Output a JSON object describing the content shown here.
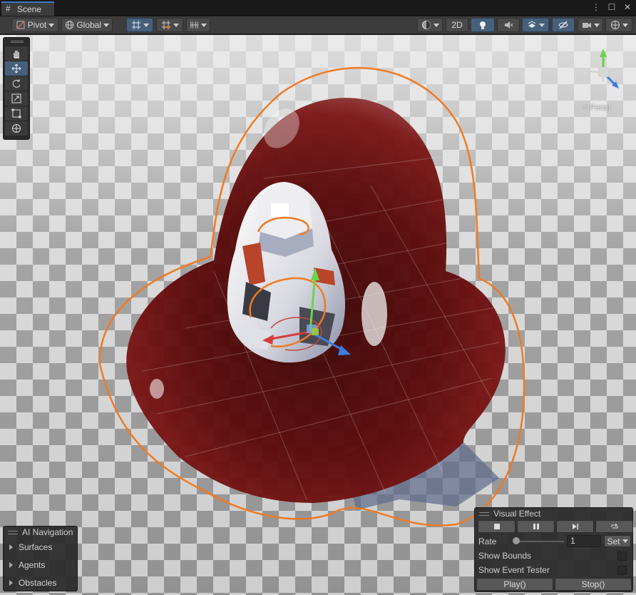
{
  "window": {
    "tab_label": "Scene",
    "menu_icon": "more-vertical-icon",
    "maximize_icon": "maximize-icon",
    "close_icon": "close-icon"
  },
  "toolbar": {
    "pivot_label": "Pivot",
    "global_label": "Global",
    "grid_snap_icon": "grid-snap-icon",
    "increment_snap_icon": "increment-snap-icon",
    "grid_visibility_icon": "grid-visibility-icon",
    "draw_mode_icon": "shading-mode-icon",
    "mode_2d_label": "2D",
    "lighting_icon": "lightbulb-icon",
    "audio_icon": "audio-mute-icon",
    "effects_icon": "effects-icon",
    "hidden_icon": "hidden-objects-icon",
    "camera_icon": "camera-icon",
    "gizmos_icon": "gizmos-icon"
  },
  "tools": [
    {
      "name": "hand-tool",
      "icon": "hand-icon",
      "active": false
    },
    {
      "name": "move-tool",
      "icon": "move-icon",
      "active": true
    },
    {
      "name": "rotate-tool",
      "icon": "rotate-icon",
      "active": false
    },
    {
      "name": "scale-tool",
      "icon": "scale-icon",
      "active": false
    },
    {
      "name": "rect-tool",
      "icon": "rect-icon",
      "active": false
    },
    {
      "name": "transform-tool",
      "icon": "transform-icon",
      "active": false
    }
  ],
  "gizmo": {
    "axis_x": "x",
    "axis_y": "y",
    "axis_z": "z",
    "projection_label": "< Persp"
  },
  "ai_navigation": {
    "title": "AI Navigation",
    "items": [
      "Surfaces",
      "Agents",
      "Obstacles"
    ]
  },
  "visual_effect": {
    "title": "Visual Effect",
    "controls": [
      "stop-icon",
      "pause-icon",
      "step-icon",
      "restart-icon"
    ],
    "rate_label": "Rate",
    "rate_value": "1",
    "set_label": "Set",
    "show_bounds_label": "Show Bounds",
    "show_event_tester_label": "Show Event Tester",
    "play_label": "Play()",
    "stop_label": "Stop()"
  },
  "colors": {
    "accent_blue": "#46607c",
    "bounds_orange": "#f07a22",
    "effect_red": "#6e0a0a",
    "axis_x": "#d43c3c",
    "axis_y": "#6cd44a",
    "axis_z": "#3c7de0"
  }
}
